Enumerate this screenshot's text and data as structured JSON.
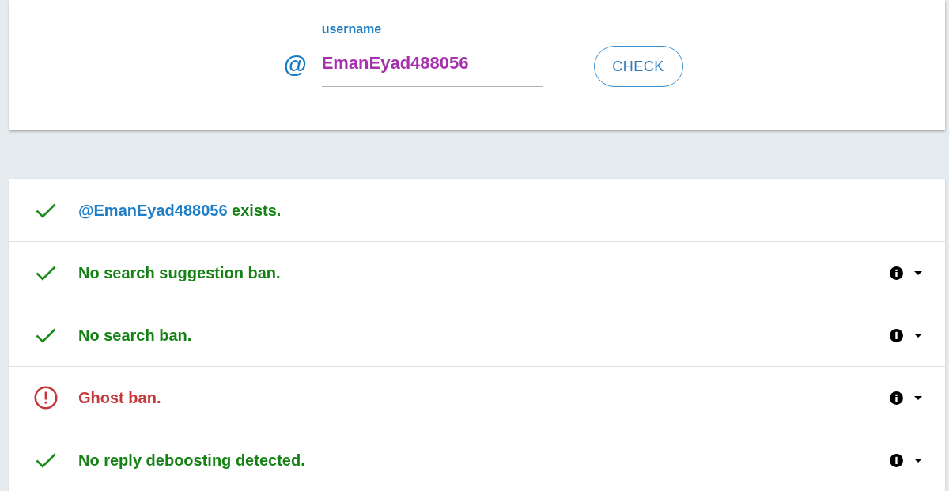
{
  "search": {
    "label": "username",
    "prefix": "@",
    "value": "EmanEyad488056",
    "button": "CHECK"
  },
  "results": [
    {
      "kind": "account",
      "passed": true,
      "handle": "@EmanEyad488056",
      "text": "exists."
    },
    {
      "kind": "test",
      "passed": true,
      "text": "No search suggestion ban.",
      "expanded": false
    },
    {
      "kind": "test",
      "passed": true,
      "text": "No search ban.",
      "expanded": false
    },
    {
      "kind": "test",
      "passed": false,
      "text": "Ghost ban.",
      "expanded": false
    },
    {
      "kind": "test",
      "passed": true,
      "text": "No reply deboosting detected.",
      "expanded": false
    }
  ]
}
